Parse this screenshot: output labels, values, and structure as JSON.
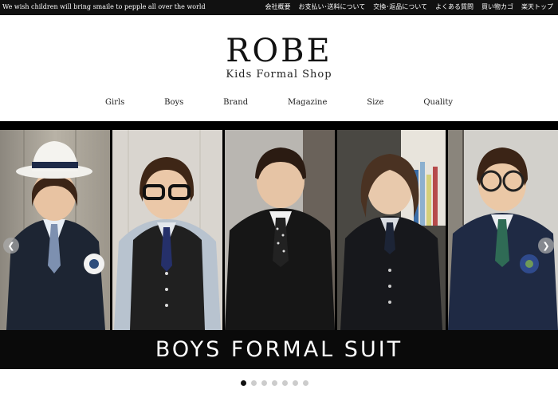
{
  "topbar": {
    "tagline": "We wish children will bring smaile to pepple all over the world",
    "links": [
      "会社概要",
      "お支払い･送料について",
      "交換･返品について",
      "よくある質問",
      "買い物カゴ",
      "楽天トップ"
    ]
  },
  "logo": {
    "brand": "ROBE",
    "subtitle": "Kids Formal Shop"
  },
  "nav": [
    "Girls",
    "Boys",
    "Brand",
    "Magazine",
    "Size",
    "Quality"
  ],
  "hero": {
    "banner_text": "BOYS FORMAL SUIT",
    "prev_icon": "chevron-left-icon",
    "next_icon": "chevron-right-icon",
    "slide_count": 7,
    "active_slide": 1
  },
  "colors": {
    "background": "#ffffff",
    "bar": "#111111",
    "banner": "#0a0a0a",
    "dot_active": "#111111",
    "dot_inactive": "#cccccc"
  }
}
